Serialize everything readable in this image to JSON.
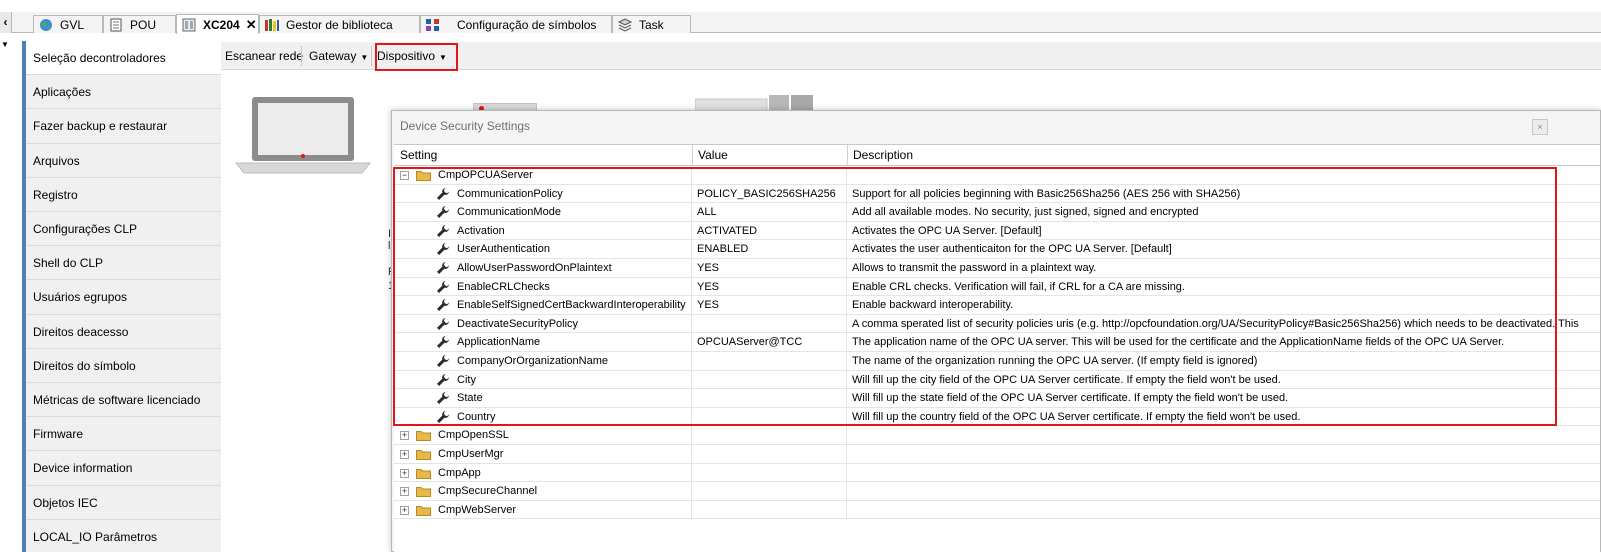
{
  "tabs": [
    {
      "label": "GVL",
      "icon": "globe-icon"
    },
    {
      "label": "POU",
      "icon": "document-icon"
    },
    {
      "label": "XC204",
      "icon": "device-icon",
      "close": "✕"
    },
    {
      "label": "Gestor de biblioteca",
      "icon": "library-books-icon"
    },
    {
      "label": "Configuração de símbolos",
      "icon": "symbol-config-icon"
    },
    {
      "label": "Task",
      "icon": "task-icon"
    }
  ],
  "sidebar": {
    "items": [
      {
        "label": "Seleção decontroladores"
      },
      {
        "label": "Aplicações"
      },
      {
        "label": "Fazer backup e restaurar"
      },
      {
        "label": "Arquivos"
      },
      {
        "label": "Registro"
      },
      {
        "label": "Configurações CLP"
      },
      {
        "label": "Shell do CLP"
      },
      {
        "label": "Usuários egrupos"
      },
      {
        "label": "Direitos deacesso"
      },
      {
        "label": "Direitos do símbolo"
      },
      {
        "label": "Métricas de software licenciado"
      },
      {
        "label": "Firmware"
      },
      {
        "label": "Device information"
      },
      {
        "label": "Objetos IEC"
      },
      {
        "label": "LOCAL_IO Parâmetros"
      }
    ]
  },
  "toolbar": {
    "scan_label": "Escanear rede",
    "gateway_label": "Gateway",
    "device_label": "Dispositivo",
    "caret": "▼"
  },
  "background": {
    "chars": [
      "I",
      "l",
      "P",
      "1"
    ]
  },
  "dialog": {
    "title": "Device Security Settings",
    "close_glyph": "×",
    "columns": [
      "Setting",
      "Value",
      "Description"
    ],
    "rows": [
      {
        "kind": "group",
        "expanded": true,
        "expander": "−",
        "setting": "CmpOPCUAServer",
        "value": "",
        "description": ""
      },
      {
        "kind": "item",
        "setting": "CommunicationPolicy",
        "value": "POLICY_BASIC256SHA256",
        "description": "Support for all policies beginning with Basic256Sha256 (AES 256 with SHA256)"
      },
      {
        "kind": "item",
        "setting": "CommunicationMode",
        "value": "ALL",
        "description": "Add all available modes. No security, just signed, signed and encrypted"
      },
      {
        "kind": "item",
        "setting": "Activation",
        "value": "ACTIVATED",
        "description": "Activates the OPC UA Server. [Default]"
      },
      {
        "kind": "item",
        "setting": "UserAuthentication",
        "value": "ENABLED",
        "description": "Activates the user authenticaiton for the OPC UA Server. [Default]"
      },
      {
        "kind": "item",
        "setting": "AllowUserPasswordOnPlaintext",
        "value": "YES",
        "description": "Allows to transmit the password in a plaintext way."
      },
      {
        "kind": "item",
        "setting": "EnableCRLChecks",
        "value": "YES",
        "description": "Enable CRL checks. Verification will fail, if CRL for a CA are missing."
      },
      {
        "kind": "item",
        "setting": "EnableSelfSignedCertBackwardInteroperability",
        "value": "YES",
        "description": "Enable backward interoperability."
      },
      {
        "kind": "item",
        "setting": "DeactivateSecurityPolicy",
        "value": "",
        "description": "A comma sperated list of security policies uris (e.g. http://opcfoundation.org/UA/SecurityPolicy#Basic256Sha256) which needs to be deactivated. This"
      },
      {
        "kind": "item",
        "setting": "ApplicationName",
        "value": "OPCUAServer@TCC",
        "description": "The application name of the OPC UA server. This will be used for the certificate and the ApplicationName fields of the OPC UA Server."
      },
      {
        "kind": "item",
        "setting": "CompanyOrOrganizationName",
        "value": "",
        "description": "The name of the organization running the OPC UA server. (If empty field is ignored)"
      },
      {
        "kind": "item",
        "setting": "City",
        "value": "",
        "description": "Will fill up the city field of the OPC UA Server certificate. If empty the field won't be used."
      },
      {
        "kind": "item",
        "setting": "State",
        "value": "",
        "description": "Will fill up the state field of the OPC UA Server certificate. If empty the field won't be used."
      },
      {
        "kind": "item",
        "setting": "Country",
        "value": "",
        "description": "Will fill up the country field of the OPC UA Server certificate. If empty the field won't be used."
      },
      {
        "kind": "group",
        "expanded": false,
        "expander": "+",
        "setting": "CmpOpenSSL",
        "value": "",
        "description": ""
      },
      {
        "kind": "group",
        "expanded": false,
        "expander": "+",
        "setting": "CmpUserMgr",
        "value": "",
        "description": ""
      },
      {
        "kind": "group",
        "expanded": false,
        "expander": "+",
        "setting": "CmpApp",
        "value": "",
        "description": ""
      },
      {
        "kind": "group",
        "expanded": false,
        "expander": "+",
        "setting": "CmpSecureChannel",
        "value": "",
        "description": ""
      },
      {
        "kind": "group",
        "expanded": false,
        "expander": "+",
        "setting": "CmpWebServer",
        "value": "",
        "description": ""
      }
    ]
  },
  "colors": {
    "highlight": "#e0161d",
    "sidebar_accent": "#4e7fb8",
    "folder": "#e8b84a"
  }
}
